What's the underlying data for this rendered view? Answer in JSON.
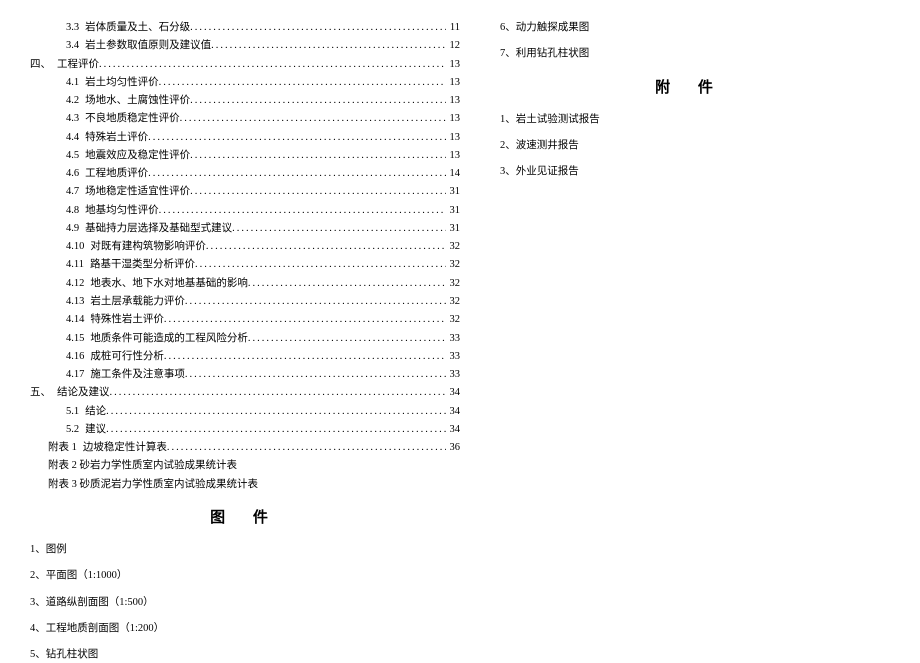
{
  "toc": [
    {
      "indent": 2,
      "num": "3.3",
      "title": "岩体质量及土、石分级",
      "page": "11"
    },
    {
      "indent": 2,
      "num": "3.4",
      "title": "岩土参数取值原则及建议值",
      "page": "12"
    },
    {
      "indent": 0,
      "num": "四、",
      "title": "工程评价",
      "page": "13"
    },
    {
      "indent": 2,
      "num": "4.1",
      "title": "岩土均匀性评价",
      "page": "13"
    },
    {
      "indent": 2,
      "num": "4.2",
      "title": "场地水、土腐蚀性评价",
      "page": "13"
    },
    {
      "indent": 2,
      "num": "4.3",
      "title": "不良地质稳定性评价",
      "page": "13"
    },
    {
      "indent": 2,
      "num": "4.4",
      "title": "特殊岩土评价",
      "page": "13"
    },
    {
      "indent": 2,
      "num": "4.5",
      "title": "地震效应及稳定性评价",
      "page": "13"
    },
    {
      "indent": 2,
      "num": "4.6",
      "title": "工程地质评价",
      "page": "14"
    },
    {
      "indent": 2,
      "num": "4.7",
      "title": "场地稳定性适宜性评价",
      "page": "31"
    },
    {
      "indent": 2,
      "num": "4.8",
      "title": "地基均匀性评价",
      "page": "31"
    },
    {
      "indent": 2,
      "num": "4.9",
      "title": "基础持力层选择及基础型式建议",
      "page": "31"
    },
    {
      "indent": 2,
      "num": "4.10",
      "title": "对既有建构筑物影响评价",
      "page": "32"
    },
    {
      "indent": 2,
      "num": "4.11",
      "title": "路基干湿类型分析评价",
      "page": "32"
    },
    {
      "indent": 2,
      "num": "4.12",
      "title": "地表水、地下水对地基基础的影响",
      "page": "32"
    },
    {
      "indent": 2,
      "num": "4.13",
      "title": "岩土层承载能力评价",
      "page": "32"
    },
    {
      "indent": 2,
      "num": "4.14",
      "title": "特殊性岩土评价",
      "page": "32"
    },
    {
      "indent": 2,
      "num": "4.15",
      "title": "地质条件可能造成的工程风险分析",
      "page": "33"
    },
    {
      "indent": 2,
      "num": "4.16",
      "title": "成桩可行性分析",
      "page": "33"
    },
    {
      "indent": 2,
      "num": "4.17",
      "title": "施工条件及注意事项",
      "page": "33"
    },
    {
      "indent": 0,
      "num": "五、",
      "title": "结论及建议",
      "page": "34"
    },
    {
      "indent": 2,
      "num": "5.1",
      "title": "结论",
      "page": "34"
    },
    {
      "indent": 2,
      "num": "5.2",
      "title": "建议",
      "page": "34"
    },
    {
      "indent": 1,
      "num": "附表 1",
      "title": "边坡稳定性计算表",
      "page": "36"
    }
  ],
  "toc_plain": [
    "附表 2 砂岩力学性质室内试验成果统计表",
    "附表 3 砂质泥岩力学性质室内试验成果统计表"
  ],
  "heading_figures": "图  件",
  "figures_left": [
    "1、图例",
    "2、平面图（1:1000）",
    "3、道路纵剖面图（1:500）",
    "4、工程地质剖面图（1:200）",
    "5、钻孔柱状图"
  ],
  "figures_right": [
    "6、动力触探成果图",
    "7、利用钻孔柱状图"
  ],
  "heading_attachments": "附  件",
  "attachments": [
    "1、岩土试验测试报告",
    "2、波速测井报告",
    "3、外业见证报告"
  ],
  "dots_fill": "................................................................................................................"
}
